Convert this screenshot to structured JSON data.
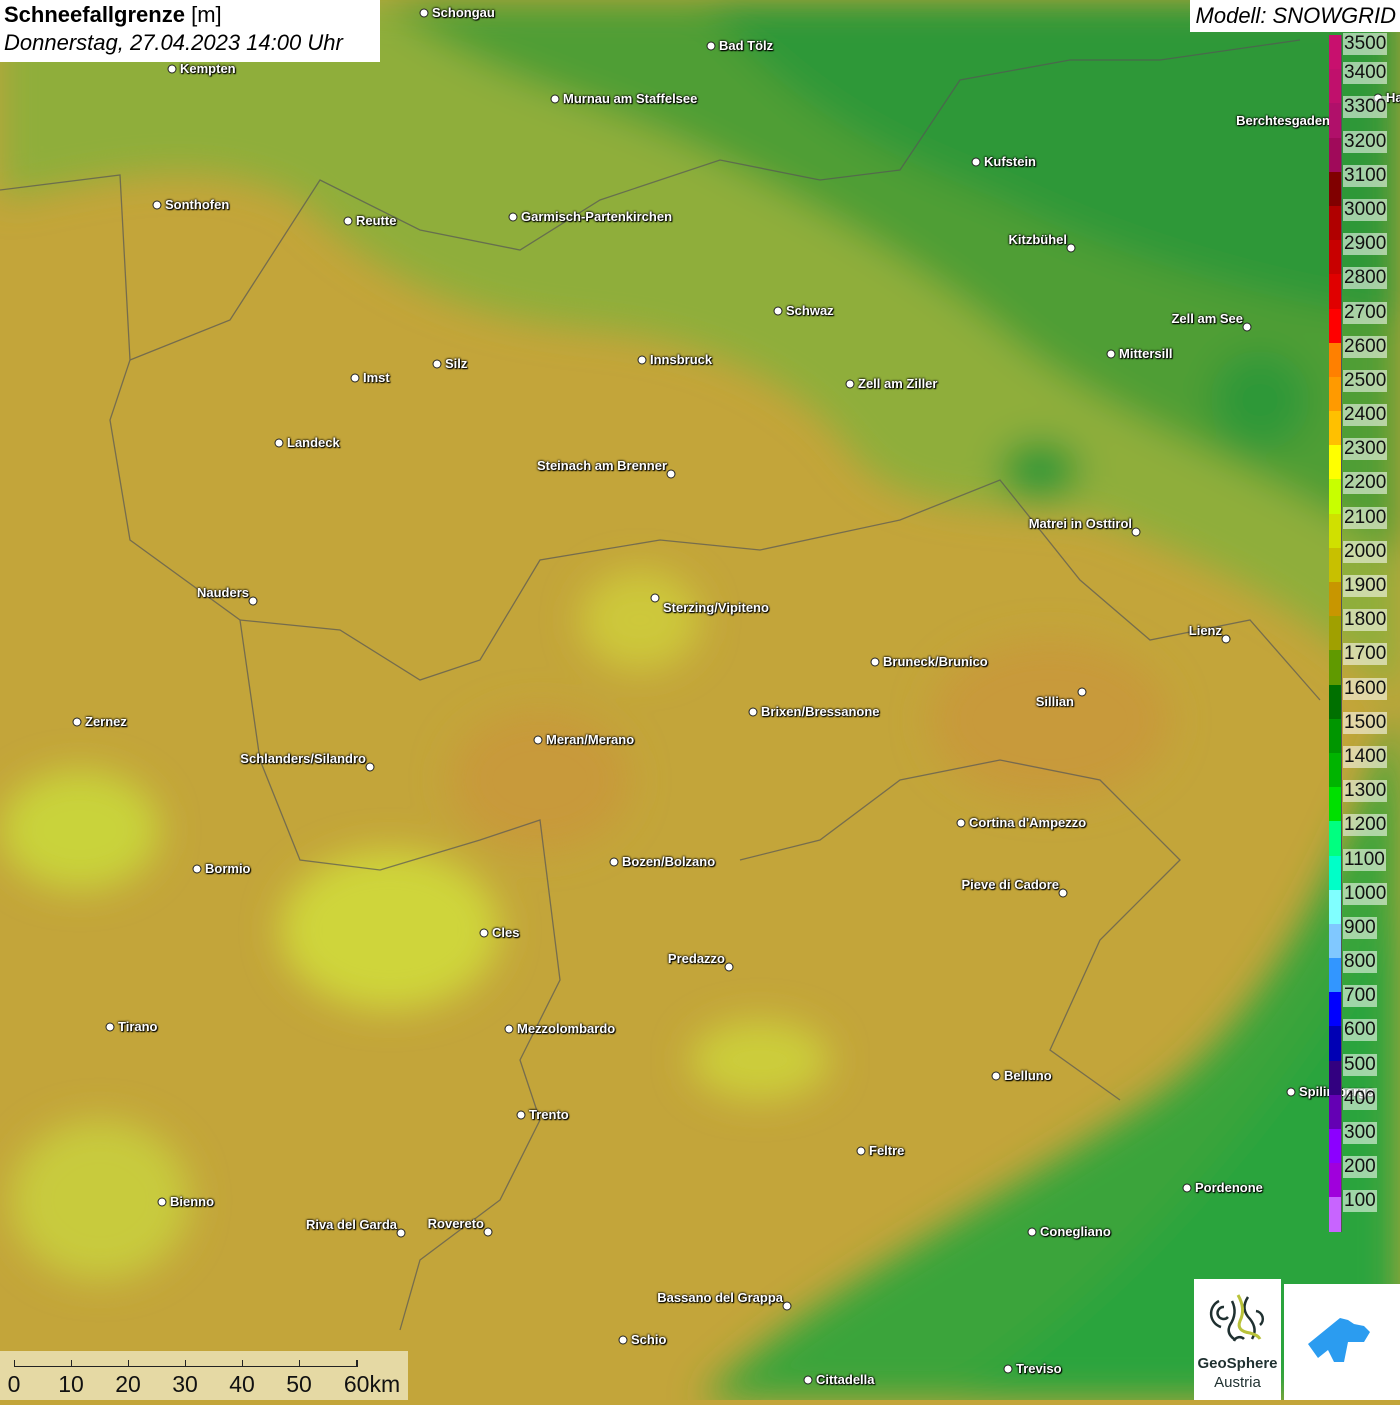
{
  "header": {
    "title_bold": "Schneefallgrenze",
    "title_unit": "[m]",
    "datetime": "Donnerstag, 27.04.2023 14:00 Uhr"
  },
  "model": "Modell: SNOWGRID",
  "legend": {
    "unit": "m",
    "items": [
      {
        "label": "3500",
        "color": "#c8106e"
      },
      {
        "label": "3400",
        "color": "#c0106c"
      },
      {
        "label": "3300",
        "color": "#b0106a"
      },
      {
        "label": "3200",
        "color": "#a00a5a"
      },
      {
        "label": "3100",
        "color": "#800000"
      },
      {
        "label": "3000",
        "color": "#b00000"
      },
      {
        "label": "2900",
        "color": "#c80000"
      },
      {
        "label": "2800",
        "color": "#e00000"
      },
      {
        "label": "2700",
        "color": "#ff0000"
      },
      {
        "label": "2600",
        "color": "#ff8000"
      },
      {
        "label": "2500",
        "color": "#ff9a00"
      },
      {
        "label": "2400",
        "color": "#ffc000"
      },
      {
        "label": "2300",
        "color": "#ffff00"
      },
      {
        "label": "2200",
        "color": "#c8ff00"
      },
      {
        "label": "2100",
        "color": "#d0e000"
      },
      {
        "label": "2000",
        "color": "#c8c000"
      },
      {
        "label": "1900",
        "color": "#c89600"
      },
      {
        "label": "1800",
        "color": "#a0a000"
      },
      {
        "label": "1700",
        "color": "#609a00"
      },
      {
        "label": "1600",
        "color": "#007000"
      },
      {
        "label": "1500",
        "color": "#009600"
      },
      {
        "label": "1400",
        "color": "#00b400"
      },
      {
        "label": "1300",
        "color": "#00e000"
      },
      {
        "label": "1200",
        "color": "#00ff80"
      },
      {
        "label": "1100",
        "color": "#00ffc8"
      },
      {
        "label": "1000",
        "color": "#80ffff"
      },
      {
        "label": "900",
        "color": "#80c8ff"
      },
      {
        "label": "800",
        "color": "#3296ff"
      },
      {
        "label": "700",
        "color": "#0000ff"
      },
      {
        "label": "600",
        "color": "#0000b4"
      },
      {
        "label": "500",
        "color": "#320080"
      },
      {
        "label": "400",
        "color": "#6400b4"
      },
      {
        "label": "300",
        "color": "#8c00ff"
      },
      {
        "label": "200",
        "color": "#a000dc"
      },
      {
        "label": "100",
        "color": "#c864ff"
      }
    ]
  },
  "cities": [
    "Schongau",
    "Bad Tölz",
    "Kempten",
    "Murnau am Staffelsee",
    "Kufstein",
    "Berchtesgaden",
    "Hallein",
    "Sonthofen",
    "Reutte",
    "Garmisch-Partenkirchen",
    "Kitzbühel",
    "Schwaz",
    "Zell am See",
    "Innsbruck",
    "Mittersill",
    "Silz",
    "Imst",
    "Zell am Ziller",
    "Landeck",
    "Steinach am Brenner",
    "Matrei in Osttirol",
    "Nauders",
    "Sterzing/Vipiteno",
    "Lienz",
    "Bruneck/Brunico",
    "Sillian",
    "Brixen/Bressanone",
    "Zernez",
    "Meran/Merano",
    "Schlanders/Silandro",
    "Cortina d'Ampezzo",
    "Bozen/Bolzano",
    "Bormio",
    "Pieve di Cadore",
    "Cles",
    "Predazzo",
    "Tirano",
    "Mezzolombardo",
    "Belluno",
    "Spilimbergo",
    "Trento",
    "Feltre",
    "Pordenone",
    "Bienno",
    "Riva del Garda",
    "Rovereto",
    "Conegliano",
    "Bassano del Grappa",
    "Schio",
    "Treviso",
    "Cittadella"
  ],
  "scale": {
    "labels": [
      "0",
      "10",
      "20",
      "30",
      "40",
      "50",
      "60km"
    ]
  },
  "logos": {
    "geosphere_line1": "GeoSphere",
    "geosphere_line2": "Austria"
  }
}
